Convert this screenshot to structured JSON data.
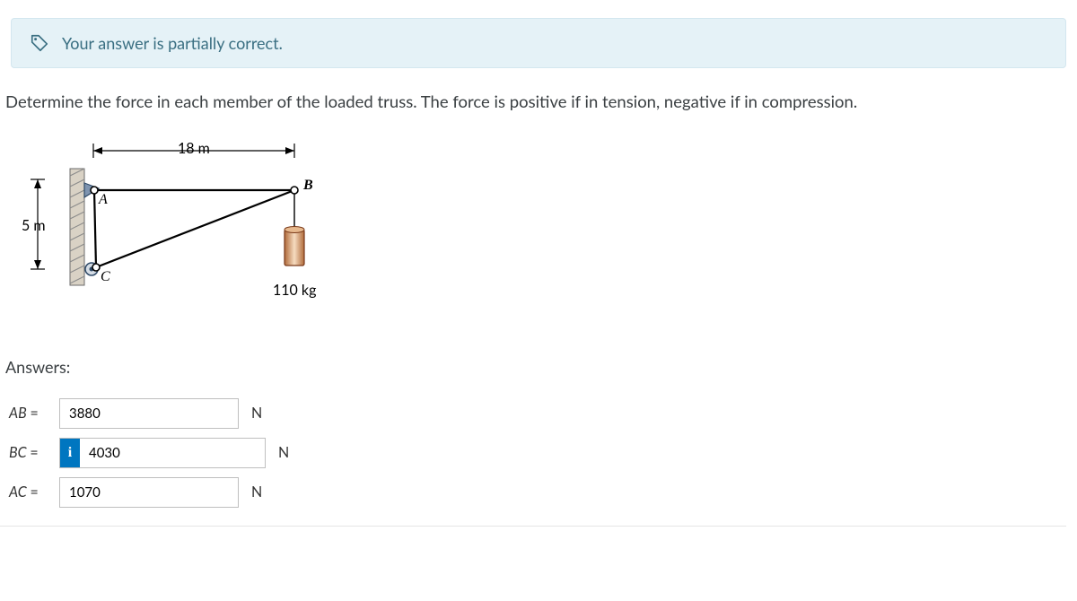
{
  "alert": {
    "text": "Your answer is partially correct."
  },
  "prompt": "Determine the force in each member of the loaded truss. The force is positive if in tension, negative if in compression.",
  "figure": {
    "top_dim": "18 m",
    "left_dim": "5 m",
    "nodeA": "A",
    "nodeB": "B",
    "nodeC": "C",
    "load": "110 kg"
  },
  "answers": {
    "heading": "Answers:",
    "rows": [
      {
        "label": "AB",
        "value": "3880",
        "unit": "N"
      },
      {
        "label": "BC",
        "value": "4030",
        "unit": "N",
        "info": true
      },
      {
        "label": "AC",
        "value": "1070",
        "unit": "N"
      }
    ]
  }
}
